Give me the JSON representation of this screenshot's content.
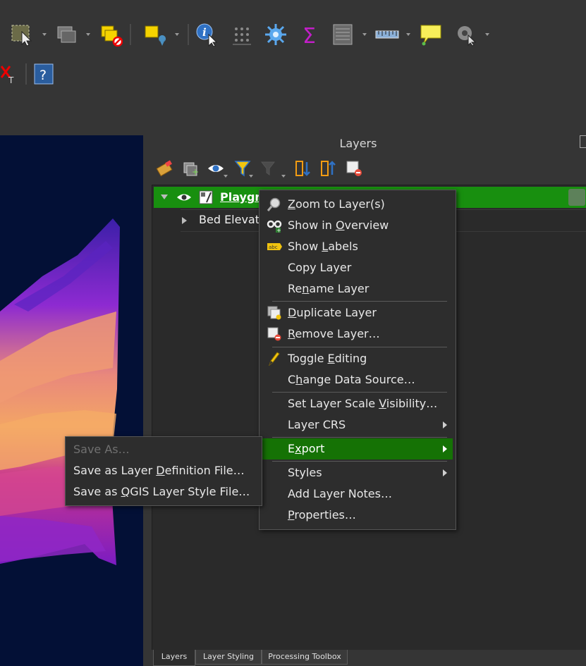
{
  "panel": {
    "title": "Layers"
  },
  "layer_tree": {
    "group_name": "Playgr",
    "child_name": "Bed Elevati"
  },
  "tabs": [
    {
      "label": "Layers"
    },
    {
      "label": "Layer Styling"
    },
    {
      "label": "Processing Toolbox"
    }
  ],
  "context_menu": {
    "items": [
      {
        "pre": "",
        "u": "Z",
        "post": "oom to Layer(s)"
      },
      {
        "pre": "Show in ",
        "u": "O",
        "post": "verview"
      },
      {
        "pre": "Show ",
        "u": "L",
        "post": "abels"
      },
      {
        "pre": "Copy Layer",
        "u": "",
        "post": ""
      },
      {
        "pre": "Re",
        "u": "n",
        "post": "ame Layer"
      },
      {
        "pre": "",
        "u": "D",
        "post": "uplicate Layer"
      },
      {
        "pre": "",
        "u": "R",
        "post": "emove Layer…"
      },
      {
        "pre": "Toggle ",
        "u": "E",
        "post": "diting"
      },
      {
        "pre": "C",
        "u": "h",
        "post": "ange Data Source…"
      },
      {
        "pre": "Set Layer Scale ",
        "u": "V",
        "post": "isibility…"
      },
      {
        "pre": "Layer CRS",
        "u": "",
        "post": ""
      },
      {
        "pre": "E",
        "u": "x",
        "post": "port"
      },
      {
        "pre": "Styles",
        "u": "",
        "post": ""
      },
      {
        "pre": "Add Layer Notes…",
        "u": "",
        "post": ""
      },
      {
        "pre": "",
        "u": "P",
        "post": "roperties…"
      }
    ],
    "highlighted": "Export"
  },
  "export_submenu": {
    "items": [
      {
        "pre": "Save As…",
        "u": "",
        "post": "",
        "disabled": true
      },
      {
        "pre": "Save as Layer ",
        "u": "D",
        "post": "efinition File…",
        "disabled": false
      },
      {
        "pre": "Save as ",
        "u": "Q",
        "post": "GIS Layer Style File…",
        "disabled": false
      }
    ]
  },
  "colors": {
    "selected_row": "#188f0f",
    "menu_highlight": "#157205",
    "map_background": "#031036"
  },
  "icons": [
    "select-features-icon",
    "layer-stack-icon",
    "deselect-icon",
    "select-by-location-icon",
    "identify-icon",
    "attribute-grid-icon",
    "settings-icon",
    "sigma-icon",
    "field-calculator-icon",
    "measure-icon",
    "map-tips-icon",
    "action-icon",
    "digitize-icon",
    "help-icon"
  ]
}
